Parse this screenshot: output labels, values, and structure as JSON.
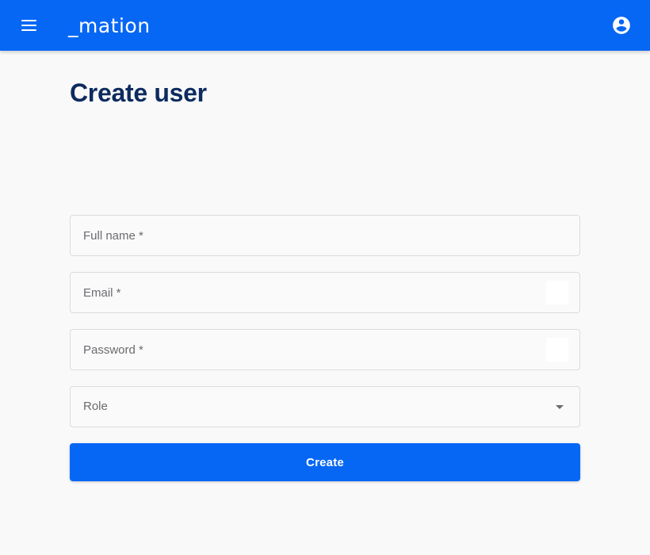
{
  "appbar": {
    "menu_icon": "hamburger-menu-icon",
    "brand_label": "_mation",
    "account_icon": "account-circle-icon",
    "background_color": "#0667f5"
  },
  "page": {
    "title": "Create user",
    "title_color": "#0d2b5e",
    "background_color": "#f9f9fa"
  },
  "form": {
    "fields": [
      {
        "name": "full-name",
        "placeholder": "Full name *",
        "value": "",
        "type": "text",
        "has_affix": false
      },
      {
        "name": "email",
        "placeholder": "Email *",
        "value": "",
        "type": "text",
        "has_affix": true,
        "affix_icon": "blank-autofill-icon"
      },
      {
        "name": "password",
        "placeholder": "Password *",
        "value": "",
        "type": "password",
        "has_affix": true,
        "affix_icon": "blank-autofill-icon"
      }
    ],
    "role_select": {
      "label": "Role",
      "selected": "",
      "caret_icon": "chevron-down-icon"
    },
    "submit": {
      "label": "Create",
      "color": "#0667f5"
    }
  }
}
